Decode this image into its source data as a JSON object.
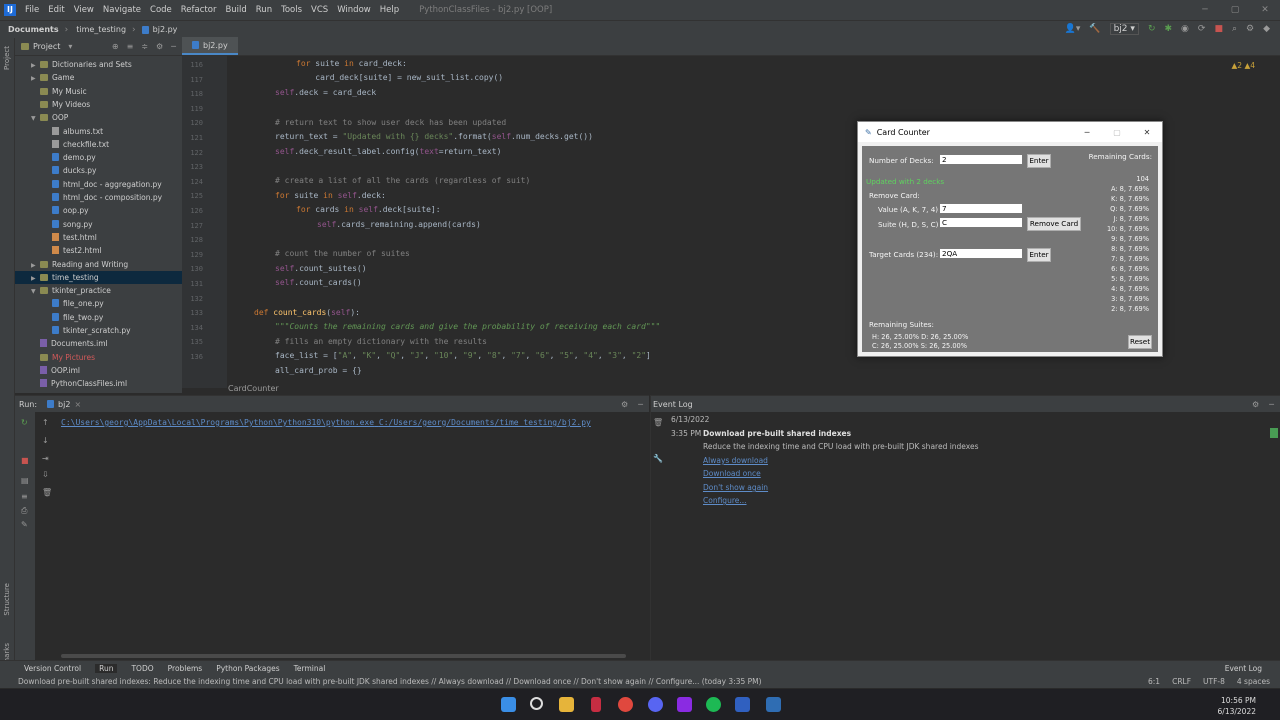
{
  "menu": {
    "items": [
      "File",
      "Edit",
      "View",
      "Navigate",
      "Code",
      "Refactor",
      "Build",
      "Run",
      "Tools",
      "VCS",
      "Window",
      "Help"
    ],
    "window_title": "PythonClassFiles - bj2.py [OOP]"
  },
  "nav": {
    "crumbs": [
      "Documents",
      "time_testing",
      "bj2.py"
    ],
    "run_config": "bj2"
  },
  "project": {
    "label": "Project",
    "tree": [
      {
        "label": "Dictionaries and Sets",
        "icon": "folder",
        "indent": 1,
        "arrow": "▶"
      },
      {
        "label": "Game",
        "icon": "folder",
        "indent": 1,
        "arrow": "▶"
      },
      {
        "label": "My Music",
        "icon": "folder",
        "indent": 1,
        "arrow": ""
      },
      {
        "label": "My Videos",
        "icon": "folder",
        "indent": 1,
        "arrow": ""
      },
      {
        "label": "OOP",
        "icon": "folder",
        "indent": 1,
        "arrow": "▼"
      },
      {
        "label": "albums.txt",
        "icon": "txt",
        "indent": 2,
        "arrow": ""
      },
      {
        "label": "checkfile.txt",
        "icon": "txt",
        "indent": 2,
        "arrow": ""
      },
      {
        "label": "demo.py",
        "icon": "py",
        "indent": 2,
        "arrow": ""
      },
      {
        "label": "ducks.py",
        "icon": "py",
        "indent": 2,
        "arrow": ""
      },
      {
        "label": "html_doc - aggregation.py",
        "icon": "py",
        "indent": 2,
        "arrow": ""
      },
      {
        "label": "html_doc - composition.py",
        "icon": "py",
        "indent": 2,
        "arrow": ""
      },
      {
        "label": "oop.py",
        "icon": "py",
        "indent": 2,
        "arrow": ""
      },
      {
        "label": "song.py",
        "icon": "py",
        "indent": 2,
        "arrow": ""
      },
      {
        "label": "test.html",
        "icon": "html",
        "indent": 2,
        "arrow": ""
      },
      {
        "label": "test2.html",
        "icon": "html",
        "indent": 2,
        "arrow": ""
      },
      {
        "label": "Reading and Writing",
        "icon": "folder",
        "indent": 1,
        "arrow": "▶"
      },
      {
        "label": "time_testing",
        "icon": "folder",
        "indent": 1,
        "arrow": "▶",
        "selected": true
      },
      {
        "label": "tkinter_practice",
        "icon": "folder",
        "indent": 1,
        "arrow": "▼"
      },
      {
        "label": "file_one.py",
        "icon": "py",
        "indent": 2,
        "arrow": ""
      },
      {
        "label": "file_two.py",
        "icon": "py",
        "indent": 2,
        "arrow": ""
      },
      {
        "label": "tkinter_scratch.py",
        "icon": "py",
        "indent": 2,
        "arrow": ""
      },
      {
        "label": "Documents.iml",
        "icon": "iml",
        "indent": 1,
        "arrow": ""
      },
      {
        "label": "My Pictures",
        "icon": "folder",
        "indent": 1,
        "arrow": "",
        "red": true
      },
      {
        "label": "OOP.iml",
        "icon": "iml",
        "indent": 1,
        "arrow": ""
      },
      {
        "label": "PythonClassFiles.iml",
        "icon": "iml",
        "indent": 1,
        "arrow": ""
      }
    ]
  },
  "editor": {
    "tab": "bj2.py",
    "footer": "CardCounter",
    "inspection": "▲2  ▲4",
    "line_numbers": [
      "116",
      "117",
      "118",
      "119",
      "120",
      "121",
      "122",
      "123",
      "124",
      "125",
      "126",
      "127",
      "128",
      "129",
      "130",
      "131",
      "132",
      "133",
      "134",
      "135",
      "136"
    ]
  },
  "run": {
    "label": "Run:",
    "config": "bj2",
    "command_a": "C:\\Users\\georg\\AppData\\Local\\Programs\\Python\\Python310\\python.exe",
    "command_b": "C:/Users/georg/Documents/time_testing/bj2.py"
  },
  "event_log": {
    "title": "Event Log",
    "date": "6/13/2022",
    "time": "3:35 PM",
    "heading": "Download pre-built shared indexes",
    "body": "Reduce the indexing time and CPU load with pre-built JDK shared indexes",
    "links": [
      "Always download",
      "Download once",
      "Don't show again",
      "Configure..."
    ]
  },
  "bottom_tools": [
    "Version Control",
    "Run",
    "TODO",
    "Problems",
    "Python Packages",
    "Terminal"
  ],
  "bottom_right": "Event Log",
  "status": {
    "message": "Download pre-built shared indexes: Reduce the indexing time and CPU load with pre-built JDK shared indexes // Always download // Download once // Don't show again // Configure... (today 3:35 PM)",
    "position": "6:1",
    "line_sep": "CRLF",
    "encoding": "UTF-8",
    "indent": "4 spaces"
  },
  "card_counter": {
    "title": "Card Counter",
    "num_decks_label": "Number of Decks:",
    "num_decks_value": "2",
    "enter_label": "Enter",
    "updated_text": "Updated with 2 decks",
    "remove_card_label": "Remove Card:",
    "value_label": "Value (A, K, 7, 4):",
    "value_input": "7",
    "suite_label": "Suite (H, D, S, C):",
    "suite_input": "C",
    "remove_button": "Remove Card",
    "target_label": "Target Cards (234):",
    "target_input": "2QA",
    "target_enter": "Enter",
    "remaining_suites_label": "Remaining Suites:",
    "suites_line1": "H: 26, 25.00%  D: 26, 25.00%",
    "suites_line2": "C: 26, 25.00%  S: 26, 25.00%",
    "reset_button": "Reset",
    "remaining_cards_label": "Remaining Cards:",
    "remaining_total": "104",
    "card_probs": [
      "A: 8, 7.69%",
      "K: 8, 7.69%",
      "Q: 8, 7.69%",
      "J: 8, 7.69%",
      "10: 8, 7.69%",
      "9: 8, 7.69%",
      "8: 8, 7.69%",
      "7: 8, 7.69%",
      "6: 8, 7.69%",
      "5: 8, 7.69%",
      "4: 8, 7.69%",
      "3: 8, 7.69%",
      "2: 8, 7.69%"
    ]
  },
  "taskbar": {
    "time": "10:56 PM",
    "date": "6/13/2022"
  }
}
